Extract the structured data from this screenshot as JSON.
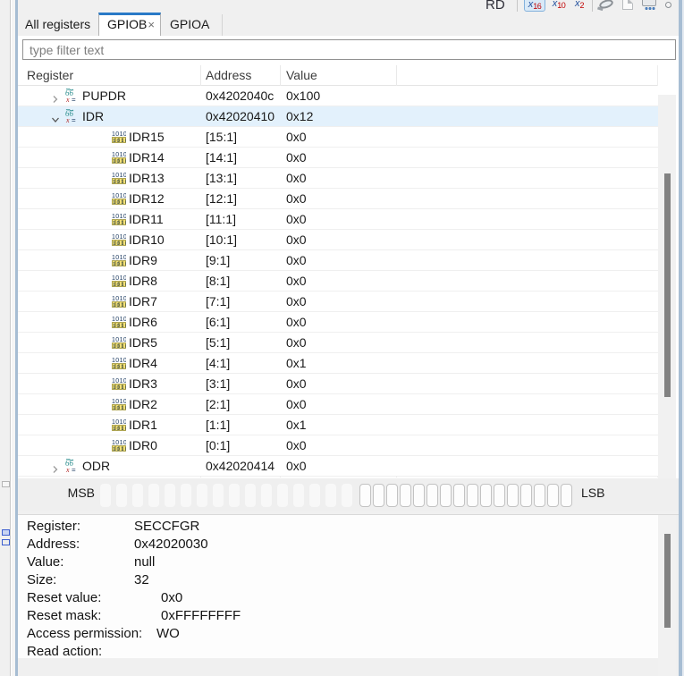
{
  "toolbar": {
    "rd_label": "RD",
    "radix_buttons": [
      {
        "prefix": "x",
        "digits": "16",
        "selected": true
      },
      {
        "prefix": "x",
        "digits": "10",
        "selected": false
      },
      {
        "prefix": "x",
        "digits": "2",
        "selected": false
      }
    ],
    "icons": [
      "watch-read-icon",
      "page-icon",
      "peripheral-chip-icon",
      "overflow-dot-icon"
    ],
    "accent_selected_bg": "#d9e9f7"
  },
  "tabs": [
    {
      "label": "All registers",
      "active": false
    },
    {
      "label": "GPIOB",
      "active": true,
      "close_glyph": "×"
    },
    {
      "label": "GPIOA",
      "active": false
    }
  ],
  "filter": {
    "placeholder": "type filter text",
    "value": ""
  },
  "table": {
    "columns": [
      "Register",
      "Address",
      "Value"
    ],
    "selected_row_color": "#e3f1fc",
    "rows": [
      {
        "type": "register",
        "expanded": false,
        "selected": false,
        "name": "PUPDR",
        "address": "0x4202040c",
        "value": "0x100"
      },
      {
        "type": "register",
        "expanded": true,
        "selected": true,
        "name": "IDR",
        "address": "0x42020410",
        "value": "0x12"
      },
      {
        "type": "bitfield",
        "name": "IDR15",
        "address": "[15:1]",
        "value": "0x0"
      },
      {
        "type": "bitfield",
        "name": "IDR14",
        "address": "[14:1]",
        "value": "0x0"
      },
      {
        "type": "bitfield",
        "name": "IDR13",
        "address": "[13:1]",
        "value": "0x0"
      },
      {
        "type": "bitfield",
        "name": "IDR12",
        "address": "[12:1]",
        "value": "0x0"
      },
      {
        "type": "bitfield",
        "name": "IDR11",
        "address": "[11:1]",
        "value": "0x0"
      },
      {
        "type": "bitfield",
        "name": "IDR10",
        "address": "[10:1]",
        "value": "0x0"
      },
      {
        "type": "bitfield",
        "name": "IDR9",
        "address": "[9:1]",
        "value": "0x0"
      },
      {
        "type": "bitfield",
        "name": "IDR8",
        "address": "[8:1]",
        "value": "0x0"
      },
      {
        "type": "bitfield",
        "name": "IDR7",
        "address": "[7:1]",
        "value": "0x0"
      },
      {
        "type": "bitfield",
        "name": "IDR6",
        "address": "[6:1]",
        "value": "0x0"
      },
      {
        "type": "bitfield",
        "name": "IDR5",
        "address": "[5:1]",
        "value": "0x0"
      },
      {
        "type": "bitfield",
        "name": "IDR4",
        "address": "[4:1]",
        "value": "0x1"
      },
      {
        "type": "bitfield",
        "name": "IDR3",
        "address": "[3:1]",
        "value": "0x0"
      },
      {
        "type": "bitfield",
        "name": "IDR2",
        "address": "[2:1]",
        "value": "0x0"
      },
      {
        "type": "bitfield",
        "name": "IDR1",
        "address": "[1:1]",
        "value": "0x1"
      },
      {
        "type": "bitfield",
        "name": "IDR0",
        "address": "[0:1]",
        "value": "0x0"
      },
      {
        "type": "register",
        "expanded": false,
        "selected": false,
        "name": "ODR",
        "address": "0x42020414",
        "value": "0x0"
      }
    ]
  },
  "bitbar": {
    "msb": "MSB",
    "lsb": "LSB",
    "plain_count": 16,
    "bordered_count": 16
  },
  "details": {
    "rows": [
      {
        "label": "Register:",
        "value": "SECCFGR"
      },
      {
        "label": "Address:",
        "value": "0x42020030"
      },
      {
        "label": "Value:",
        "value": "null"
      },
      {
        "label": "Size:",
        "value": "32"
      },
      {
        "label": "Reset value:",
        "value": "0x0"
      },
      {
        "label": "Reset mask:",
        "value": "0xFFFFFFFF"
      },
      {
        "label": "Access permission:",
        "value": "WO"
      },
      {
        "label": "Read action:",
        "value": ""
      }
    ]
  }
}
